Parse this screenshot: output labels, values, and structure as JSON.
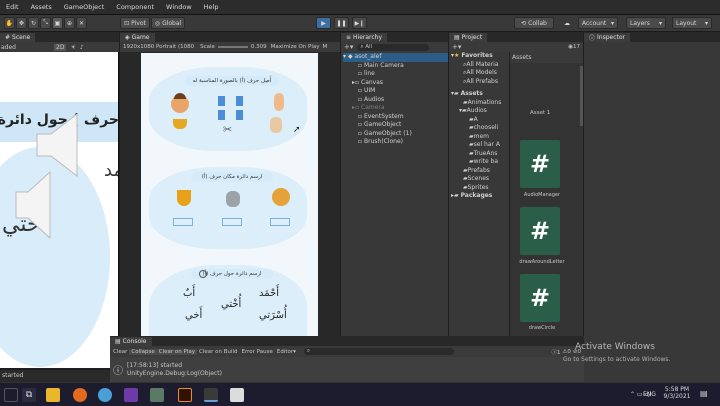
{
  "menu": [
    "Edit",
    "Assets",
    "GameObject",
    "Component",
    "Window",
    "Help"
  ],
  "toolbar": {
    "pivot": "Pivot",
    "global": "Global",
    "collab": "Collab",
    "account": "Account",
    "layers": "Layers",
    "layout": "Layout"
  },
  "scene": {
    "tab": "Scene",
    "shading": "aded",
    "mode": "2D",
    "rtl_text": "حرف ) حول دائرة م",
    "word1": "أُخْتي",
    "word2": "مد"
  },
  "game": {
    "tab": "Game",
    "resolution": "1920x1080 Portrait (1080",
    "scale_label": "Scale",
    "scale_value": "0.309",
    "maximize": "Maximize On Play",
    "m": "M",
    "card1_title": "أَصِل حرف (أ) بالصورة المناسبة له",
    "card2_title": "ارسم دائرة مكان حرف (أ)",
    "card3_title": "ارسم دائرة حول حرف (أ)",
    "words": [
      "أَحْمَد",
      "أَبٌ",
      "أُخْتي",
      "أَخي",
      "أُسْرَتي"
    ]
  },
  "hierarchy": {
    "tab": "Hierarchy",
    "search": "All",
    "scene_name": "asot_alef",
    "items": [
      "Main Camera",
      "line",
      "Canvas",
      "UIM",
      "Audios",
      "Camera",
      "EventSystem",
      "GameObject",
      "GameObject (1)",
      "Brush(Clone)"
    ]
  },
  "project": {
    "tab": "Project",
    "favorites": "Favorites",
    "fav_items": [
      "All Materia",
      "All Models",
      "All Prefabs"
    ],
    "assets": "Assets",
    "tree": [
      "Animations",
      "Audios",
      "A",
      "chooseli",
      "mem",
      "sel har A",
      "TrueAns",
      "write ba",
      "Prefabs",
      "Scenes",
      "Sprites"
    ],
    "packages": "Packages",
    "hidden_count": "17",
    "assets_header": "Assets",
    "asset_top": "Asset 1",
    "files": [
      "AudioManager",
      "drawAroundLetter",
      "drawCircle"
    ]
  },
  "inspector": {
    "tab": "Inspector"
  },
  "console": {
    "tab": "Console",
    "buttons": [
      "Clear",
      "Collapse",
      "Clear on Play",
      "Clear on Build",
      "Error Pause",
      "Editor"
    ],
    "count_msg": "1",
    "count_warn": "0",
    "count_err": "0",
    "log_line1": "[17:58:13] started",
    "log_line2": "UnityEngine.Debug:Log(Object)"
  },
  "status": {
    "left": "started"
  },
  "watermark": {
    "line1": "Activate Windows",
    "line2": "Go to Settings to activate Windows."
  },
  "taskbar": {
    "lang": "ENG",
    "time": "5:58 PM",
    "date": "9/3/2021"
  },
  "colors": {
    "accent": "#2c5d87",
    "card_bg": "#dceefa",
    "script_icon": "#2a5e48"
  }
}
